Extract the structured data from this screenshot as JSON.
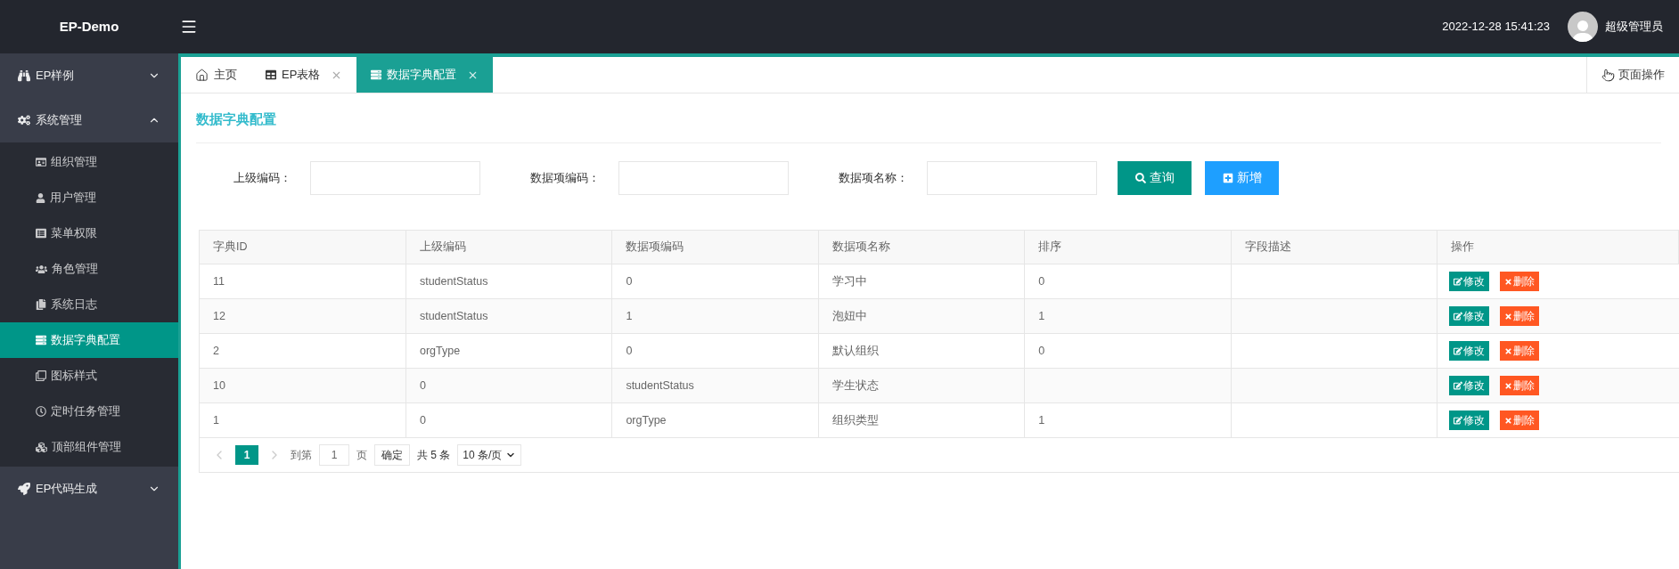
{
  "header": {
    "logo": "EP-Demo",
    "datetime": "2022-12-28 15:41:23",
    "user": "超级管理员"
  },
  "sidebar": {
    "groups": [
      {
        "label": "EP样例",
        "expanded": false
      },
      {
        "label": "系统管理",
        "expanded": true,
        "children": [
          {
            "label": "组织管理",
            "selected": false
          },
          {
            "label": "用户管理",
            "selected": false
          },
          {
            "label": "菜单权限",
            "selected": false
          },
          {
            "label": "角色管理",
            "selected": false
          },
          {
            "label": "系统日志",
            "selected": false
          },
          {
            "label": "数据字典配置",
            "selected": true
          },
          {
            "label": "图标样式",
            "selected": false
          },
          {
            "label": "定时任务管理",
            "selected": false
          },
          {
            "label": "顶部组件管理",
            "selected": false
          }
        ]
      },
      {
        "label": "EP代码生成",
        "expanded": false
      }
    ]
  },
  "tabs": [
    {
      "label": "主页",
      "selected": false,
      "closable": false
    },
    {
      "label": "EP表格",
      "selected": false,
      "closable": true
    },
    {
      "label": "数据字典配置",
      "selected": true,
      "closable": true
    }
  ],
  "page_actions": "页面操作",
  "page_title": "数据字典配置",
  "filters": [
    {
      "label": "上级编码："
    },
    {
      "label": "数据项编码："
    },
    {
      "label": "数据项名称："
    }
  ],
  "buttons": [
    {
      "label": "查询",
      "kind": "search"
    },
    {
      "label": "新增",
      "kind": "add"
    }
  ],
  "table": {
    "columns": [
      "字典ID",
      "上级编码",
      "数据项编码",
      "数据项名称",
      "排序",
      "字段描述",
      "操作"
    ],
    "rows": [
      {
        "id": "11",
        "parent_code": "studentStatus",
        "item_code": "0",
        "item_name": "学习中",
        "sort": "0",
        "actions": [
          {
            "label": "修改",
            "kind": "edit"
          },
          {
            "label": "删除",
            "kind": "delete"
          }
        ]
      },
      {
        "id": "12",
        "parent_code": "studentStatus",
        "item_code": "1",
        "item_name": "泡妞中",
        "sort": "1",
        "actions": [
          {
            "label": "修改",
            "kind": "edit"
          },
          {
            "label": "删除",
            "kind": "delete"
          }
        ]
      },
      {
        "id": "2",
        "parent_code": "orgType",
        "item_code": "0",
        "item_name": "默认组织",
        "sort": "0",
        "actions": [
          {
            "label": "修改",
            "kind": "edit"
          },
          {
            "label": "删除",
            "kind": "delete"
          }
        ]
      },
      {
        "id": "10",
        "parent_code": "0",
        "item_code": "studentStatus",
        "item_name": "学生状态",
        "actions": [
          {
            "label": "修改",
            "kind": "edit"
          },
          {
            "label": "删除",
            "kind": "delete"
          }
        ]
      },
      {
        "id": "1",
        "parent_code": "0",
        "item_code": "orgType",
        "item_name": "组织类型",
        "sort": "1",
        "actions": [
          {
            "label": "修改",
            "kind": "edit"
          },
          {
            "label": "删除",
            "kind": "delete"
          }
        ]
      }
    ]
  },
  "pagination": {
    "prev_disabled": true,
    "next_disabled": true,
    "pages": [
      {
        "label": "1",
        "selected": true
      }
    ],
    "goto_label": "到第",
    "goto_value": "1",
    "page_unit": "页",
    "confirm": "确定",
    "total": "共 5 条",
    "page_size": "10 条/页"
  }
}
